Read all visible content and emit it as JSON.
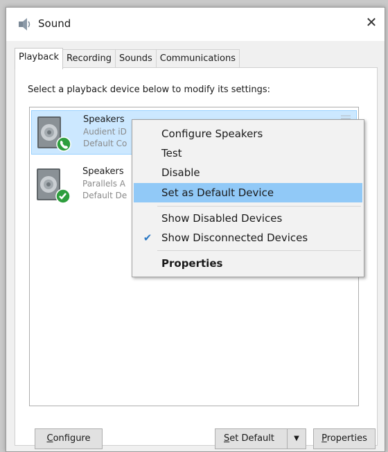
{
  "window": {
    "title": "Sound",
    "close_glyph": "✕"
  },
  "tabs": [
    {
      "label": "Playback",
      "active": true
    },
    {
      "label": "Recording",
      "active": false
    },
    {
      "label": "Sounds",
      "active": false
    },
    {
      "label": "Communications",
      "active": false
    }
  ],
  "playback": {
    "instruction": "Select a playback device below to modify its settings:",
    "devices": [
      {
        "name": "Speakers",
        "sub1": "Audient iD",
        "sub2": "Default Co",
        "status_icon": "phone-icon",
        "selected": true
      },
      {
        "name": "Speakers",
        "sub1": "Parallels A",
        "sub2": "Default De",
        "status_icon": "check-icon",
        "selected": false
      }
    ]
  },
  "context_menu": {
    "items": [
      {
        "label": "Configure Speakers"
      },
      {
        "label": "Test"
      },
      {
        "label": "Disable"
      },
      {
        "label": "Set as Default Device",
        "highlighted": true
      },
      {
        "label": "Show Disabled Devices"
      },
      {
        "label": "Show Disconnected Devices",
        "checked": true
      },
      {
        "label": "Properties",
        "bold": true
      }
    ]
  },
  "buttons": {
    "configure": {
      "accel": "C",
      "rest": "onfigure"
    },
    "set_default": {
      "accel": "S",
      "rest": "et Default"
    },
    "properties": {
      "accel": "P",
      "rest": "roperties"
    }
  },
  "colors": {
    "selection": "#cce8ff",
    "menu_highlight": "#91c9f7",
    "status_green": "#2e9e3e",
    "check_blue": "#2b78c4"
  }
}
